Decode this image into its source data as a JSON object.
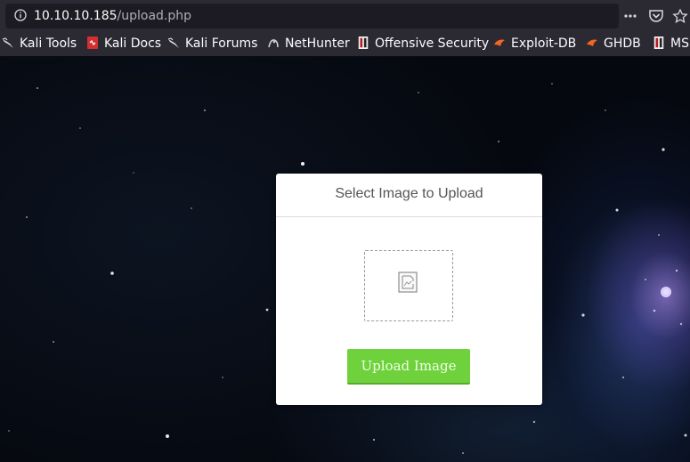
{
  "browser": {
    "url_host": "10.10.10.185",
    "url_path": "/upload.php",
    "toolbar_icons": [
      "page-actions-icon",
      "pocket-icon",
      "bookmark-star-icon"
    ]
  },
  "bookmarks": [
    {
      "label": "Kali Tools",
      "icon": "kali-dragon-icon"
    },
    {
      "label": "Kali Docs",
      "icon": "kali-docs-icon"
    },
    {
      "label": "Kali Forums",
      "icon": "kali-dragon-icon"
    },
    {
      "label": "NetHunter",
      "icon": "nethunter-icon"
    },
    {
      "label": "Offensive Security",
      "icon": "offsec-icon"
    },
    {
      "label": "Exploit-DB",
      "icon": "exploit-db-icon"
    },
    {
      "label": "GHDB",
      "icon": "exploit-db-icon"
    },
    {
      "label": "MS",
      "icon": "offsec-icon"
    }
  ],
  "card": {
    "title": "Select Image to Upload",
    "button_label": "Upload Image"
  },
  "colors": {
    "button": "#6fd23c",
    "chrome": "#2b2a33"
  }
}
